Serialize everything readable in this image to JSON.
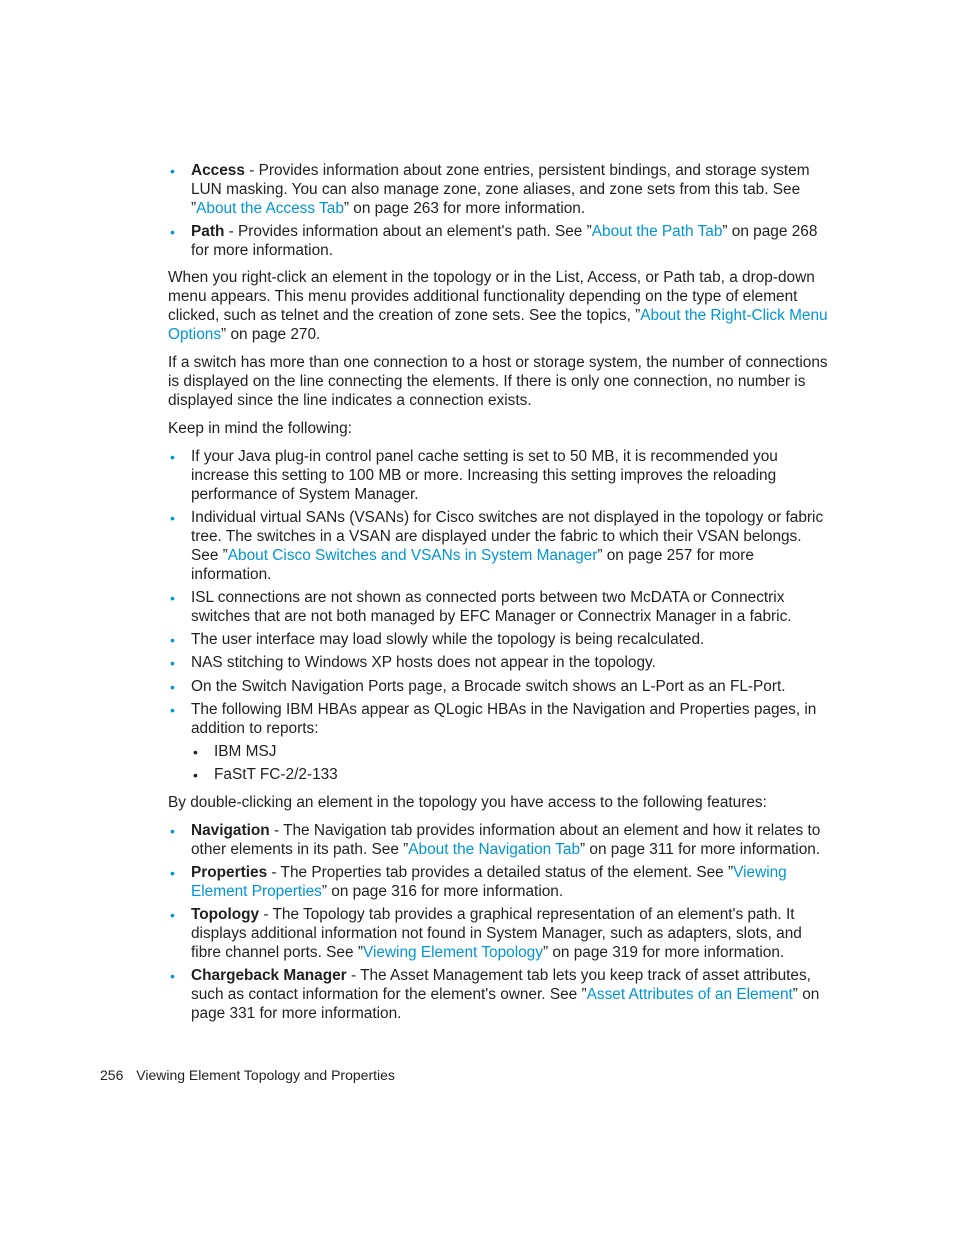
{
  "colors": {
    "link": "#0096d6",
    "bullet": "#0096d6",
    "text": "#231f20"
  },
  "tab_list": [
    {
      "term": "Access",
      "pre": " - Provides information about zone entries, persistent bindings, and storage system LUN masking. You can also manage zone, zone aliases, and zone sets from this tab. See ”",
      "link": "About the Access Tab",
      "post": "” on page 263 for more information."
    },
    {
      "term": "Path",
      "pre": " - Provides information about an element's path. See ”",
      "link": "About the Path Tab",
      "post": "” on page 268 for more information."
    }
  ],
  "para_right_click": {
    "pre": "When you right-click an element in the topology or in the List, Access, or Path tab, a drop-down menu appears. This menu provides additional functionality depending on the type of element clicked, such as telnet and the creation of zone sets. See the topics, ”",
    "link": "About the Right-Click Menu Options",
    "post": "” on page 270."
  },
  "para_switch": "If a switch has more than one connection to a host or storage system, the number of connections is displayed on the line connecting the elements. If there is only one connection, no number is displayed since the line indicates a connection exists.",
  "para_keep": "Keep in mind the following:",
  "keep_list": [
    {
      "text": "If your Java plug-in control panel cache setting is set to 50 MB, it is recommended you increase this setting to 100 MB or more. Increasing this setting improves the reloading performance of System Manager."
    },
    {
      "pre": "Individual virtual SANs (VSANs) for Cisco switches are not displayed in the topology or fabric tree. The switches in a VSAN are displayed under the fabric to which their VSAN belongs. See ”",
      "link": "About Cisco Switches and VSANs in System Manager",
      "post": "” on page 257 for more information."
    },
    {
      "text": "ISL connections are not shown as connected ports between two McDATA or Connectrix switches that are not both managed by EFC Manager or Connectrix Manager in a fabric."
    },
    {
      "text": "The user interface may load slowly while the topology is being recalculated."
    },
    {
      "text": "NAS stitching to Windows XP hosts does not appear in the topology."
    },
    {
      "text": "On the Switch Navigation Ports page, a Brocade switch shows an L-Port as an FL-Port."
    },
    {
      "text": "The following IBM HBAs appear as QLogic HBAs in the Navigation and Properties pages, in addition to reports:",
      "sub": [
        "IBM MSJ",
        "FaStT FC-2/2-133"
      ]
    }
  ],
  "para_double_click": "By double-clicking an element in the topology you have access to the following features:",
  "feature_list": [
    {
      "term": "Navigation",
      "pre": " - The Navigation tab provides information about an element and how it relates to other elements in its path. See ”",
      "link": "About the Navigation Tab",
      "post": "” on page 311 for more information."
    },
    {
      "term": "Properties",
      "pre": " - The Properties tab provides a detailed status of the element. See ”",
      "link": "Viewing Element Properties",
      "post": "” on page 316 for more information."
    },
    {
      "term": "Topology",
      "pre": " - The Topology tab provides a graphical representation of an element's path. It displays additional information not found in System Manager, such as adapters, slots, and fibre channel ports. See ”",
      "link": "Viewing Element Topology",
      "post": "” on page 319 for more information."
    },
    {
      "term": "Chargeback Manager",
      "pre": " - The Asset Management tab lets you keep track of asset attributes, such as contact information for the element's owner. See ”",
      "link": "Asset Attributes of an Element",
      "post": "” on page 331 for more information."
    }
  ],
  "footer": {
    "page_number": "256",
    "section_title": "Viewing Element Topology and Properties"
  },
  "bullet_glyph": "•"
}
